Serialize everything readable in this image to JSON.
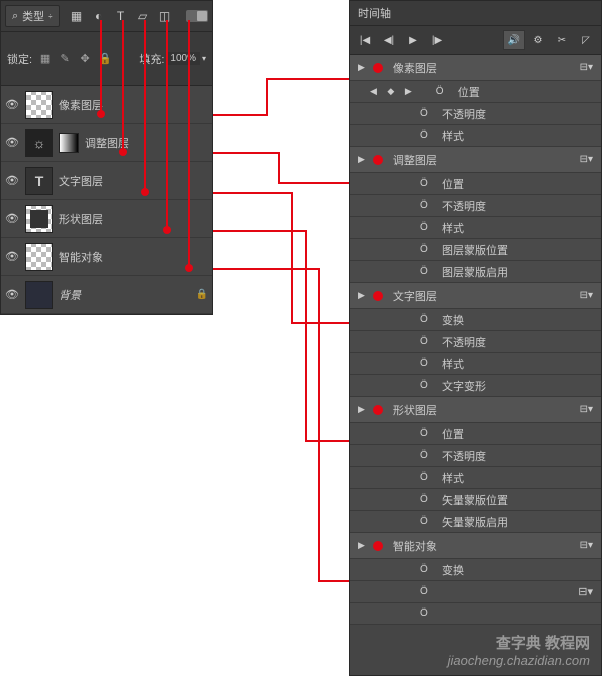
{
  "layers_panel": {
    "type_filter_label": "类型",
    "lock_label": "锁定:",
    "fill_label": "填充:",
    "fill_value": "100%",
    "layers": [
      {
        "name": "像素图层",
        "thumb": "checker"
      },
      {
        "name": "调整图层",
        "thumb": "adjust"
      },
      {
        "name": "文字图层",
        "thumb": "text"
      },
      {
        "name": "形状图层",
        "thumb": "shape"
      },
      {
        "name": "智能对象",
        "thumb": "smart"
      },
      {
        "name": "背景",
        "thumb": "solid",
        "locked": true,
        "italic": true
      }
    ]
  },
  "timeline_panel": {
    "title": "时间轴",
    "groups": [
      {
        "name": "像素图层",
        "children": [
          {
            "label": "位置",
            "arrows": true
          },
          {
            "label": "不透明度"
          },
          {
            "label": "样式"
          }
        ]
      },
      {
        "name": "调整图层",
        "children": [
          {
            "label": "位置"
          },
          {
            "label": "不透明度"
          },
          {
            "label": "样式"
          },
          {
            "label": "图层蒙版位置"
          },
          {
            "label": "图层蒙版启用"
          }
        ]
      },
      {
        "name": "文字图层",
        "children": [
          {
            "label": "变换"
          },
          {
            "label": "不透明度"
          },
          {
            "label": "样式"
          },
          {
            "label": "文字变形"
          }
        ]
      },
      {
        "name": "形状图层",
        "children": [
          {
            "label": "位置"
          },
          {
            "label": "不透明度"
          },
          {
            "label": "样式"
          },
          {
            "label": "矢量蒙版位置"
          },
          {
            "label": "矢量蒙版启用"
          }
        ]
      },
      {
        "name": "智能对象",
        "children": [
          {
            "label": "变换"
          },
          {
            "label": ""
          },
          {
            "label": ""
          }
        ]
      }
    ]
  },
  "watermark": {
    "cn": "查字典 教程网",
    "url": "jiaocheng.chazidian.com"
  },
  "colors": {
    "red": "#e30613",
    "panel": "#454545"
  }
}
